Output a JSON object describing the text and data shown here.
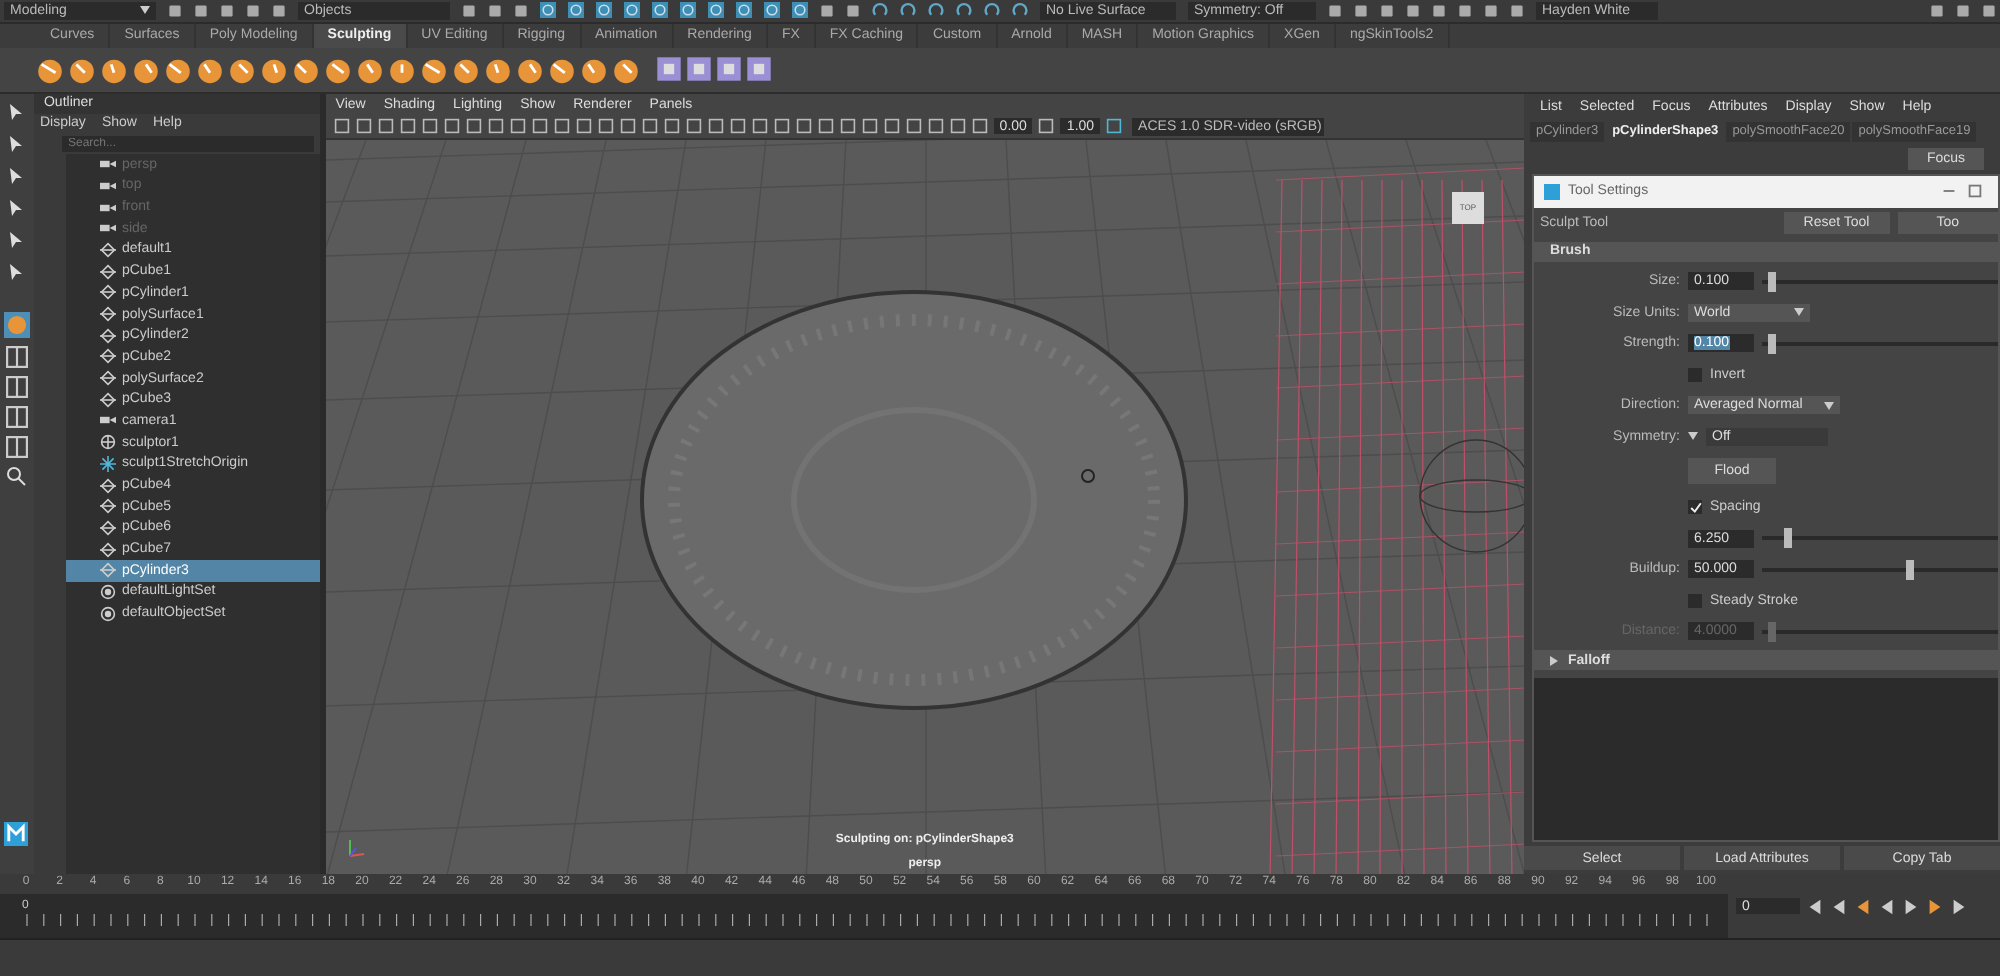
{
  "status_line": {
    "menu_set": "Modeling",
    "selection_mode": "Objects",
    "live_surface": "No Live Surface",
    "symmetry": "Symmetry: Off",
    "user": "Hayden White"
  },
  "shelf_tabs": [
    {
      "label": "Curves",
      "selected": false
    },
    {
      "label": "Surfaces",
      "selected": false
    },
    {
      "label": "Poly Modeling",
      "selected": false
    },
    {
      "label": "Sculpting",
      "selected": true
    },
    {
      "label": "UV Editing",
      "selected": false
    },
    {
      "label": "Rigging",
      "selected": false
    },
    {
      "label": "Animation",
      "selected": false
    },
    {
      "label": "Rendering",
      "selected": false
    },
    {
      "label": "FX",
      "selected": false
    },
    {
      "label": "FX Caching",
      "selected": false
    },
    {
      "label": "Custom",
      "selected": false
    },
    {
      "label": "Arnold",
      "selected": false
    },
    {
      "label": "MASH",
      "selected": false
    },
    {
      "label": "Motion Graphics",
      "selected": false
    },
    {
      "label": "XGen",
      "selected": false
    },
    {
      "label": "ngSkinTools2",
      "selected": false
    }
  ],
  "outliner": {
    "title": "Outliner",
    "menus": [
      "Display",
      "Show",
      "Help"
    ],
    "search": {
      "placeholder": "Search..."
    },
    "items": [
      {
        "name": "persp",
        "kind": "camera",
        "hidden": true,
        "selected": false
      },
      {
        "name": "top",
        "kind": "camera",
        "hidden": true,
        "selected": false
      },
      {
        "name": "front",
        "kind": "camera",
        "hidden": true,
        "selected": false
      },
      {
        "name": "side",
        "kind": "camera",
        "hidden": true,
        "selected": false
      },
      {
        "name": "default1",
        "kind": "transform",
        "hidden": false,
        "selected": false
      },
      {
        "name": "pCube1",
        "kind": "transform",
        "hidden": false,
        "selected": false
      },
      {
        "name": "pCylinder1",
        "kind": "transform",
        "hidden": false,
        "selected": false
      },
      {
        "name": "polySurface1",
        "kind": "transform",
        "hidden": false,
        "selected": false
      },
      {
        "name": "pCylinder2",
        "kind": "transform",
        "hidden": false,
        "selected": false
      },
      {
        "name": "pCube2",
        "kind": "transform",
        "hidden": false,
        "selected": false
      },
      {
        "name": "polySurface2",
        "kind": "transform",
        "hidden": false,
        "selected": false
      },
      {
        "name": "pCube3",
        "kind": "transform",
        "hidden": false,
        "selected": false
      },
      {
        "name": "camera1",
        "kind": "camera",
        "hidden": false,
        "selected": false
      },
      {
        "name": "sculptor1",
        "kind": "sculptor",
        "hidden": false,
        "selected": false
      },
      {
        "name": "sculpt1StretchOrigin",
        "kind": "locator",
        "hidden": false,
        "selected": false
      },
      {
        "name": "pCube4",
        "kind": "transform",
        "hidden": false,
        "selected": false
      },
      {
        "name": "pCube5",
        "kind": "transform",
        "hidden": false,
        "selected": false
      },
      {
        "name": "pCube6",
        "kind": "transform",
        "hidden": false,
        "selected": false
      },
      {
        "name": "pCube7",
        "kind": "transform",
        "hidden": false,
        "selected": false
      },
      {
        "name": "pCylinder3",
        "kind": "transform",
        "hidden": false,
        "selected": true
      },
      {
        "name": "defaultLightSet",
        "kind": "set",
        "hidden": false,
        "selected": false
      },
      {
        "name": "defaultObjectSet",
        "kind": "set",
        "hidden": false,
        "selected": false
      }
    ]
  },
  "viewport": {
    "menus": [
      "View",
      "Shading",
      "Lighting",
      "Show",
      "Renderer",
      "Panels"
    ],
    "exposure": "0.00",
    "gamma": "1.00",
    "color_space": "ACES 1.0 SDR-video (sRGB)",
    "view_cube": "TOP",
    "hud_status": "Sculpting on: pCylinderShape3",
    "camera": "persp"
  },
  "attribute_editor": {
    "menus": [
      "List",
      "Selected",
      "Focus",
      "Attributes",
      "Display",
      "Show",
      "Help"
    ],
    "tabs": [
      {
        "label": "pCylinder3",
        "selected": false
      },
      {
        "label": "pCylinderShape3",
        "selected": true
      },
      {
        "label": "polySmoothFace20",
        "selected": false
      },
      {
        "label": "polySmoothFace19",
        "selected": false
      }
    ],
    "focus_button": "Focus",
    "buttons": [
      "Select",
      "Load Attributes",
      "Copy Tab"
    ]
  },
  "tool_settings": {
    "title": "Tool Settings",
    "tool": "Sculpt Tool",
    "buttons": [
      "Reset Tool",
      "Too"
    ],
    "sections": [
      {
        "title": "Brush",
        "expanded": true,
        "rows": [
          {
            "kind": "slider",
            "label": "Size:",
            "value": "0.100",
            "level": 0.02,
            "highlighted": false,
            "disabled": false
          },
          {
            "kind": "dropdown",
            "label": "Size Units:",
            "value": "World"
          },
          {
            "kind": "slider",
            "label": "Strength:",
            "value": "0.100",
            "level": 0.02,
            "highlighted": true,
            "disabled": false
          },
          {
            "kind": "checkbox",
            "label": "Invert",
            "checked": false
          },
          {
            "kind": "dropdown",
            "label": "Direction:",
            "value": "Averaged Normal"
          },
          {
            "kind": "symmetry",
            "label": "Symmetry:",
            "value": "Off"
          },
          {
            "kind": "button",
            "label": "Flood"
          },
          {
            "kind": "checkbox",
            "label": "Spacing",
            "checked": true
          },
          {
            "kind": "slider",
            "value": "6.250",
            "level": 0.08,
            "highlighted": false,
            "disabled": false
          },
          {
            "kind": "slider",
            "label": "Buildup:",
            "value": "50.000",
            "level": 0.52,
            "highlighted": false,
            "disabled": false
          },
          {
            "kind": "checkbox",
            "label": "Steady Stroke",
            "checked": false
          },
          {
            "kind": "slider",
            "label": "Distance:",
            "value": "4.0000",
            "level": 0.02,
            "highlighted": false,
            "disabled": true
          }
        ]
      },
      {
        "title": "Falloff",
        "expanded": false
      }
    ]
  },
  "timeline": {
    "frames": [
      "0",
      "2",
      "4",
      "6",
      "8",
      "10",
      "12",
      "14",
      "16",
      "18",
      "20",
      "22",
      "24",
      "26",
      "28",
      "30",
      "32",
      "34",
      "36",
      "38",
      "40",
      "42",
      "44",
      "46",
      "48",
      "50",
      "52",
      "54",
      "56",
      "58",
      "60",
      "62",
      "64",
      "66",
      "68",
      "70",
      "72",
      "74",
      "76",
      "78",
      "80",
      "82",
      "84",
      "86",
      "88",
      "90",
      "92",
      "94",
      "96",
      "98",
      "100"
    ],
    "current_frame": "0",
    "start_frame": "0"
  }
}
